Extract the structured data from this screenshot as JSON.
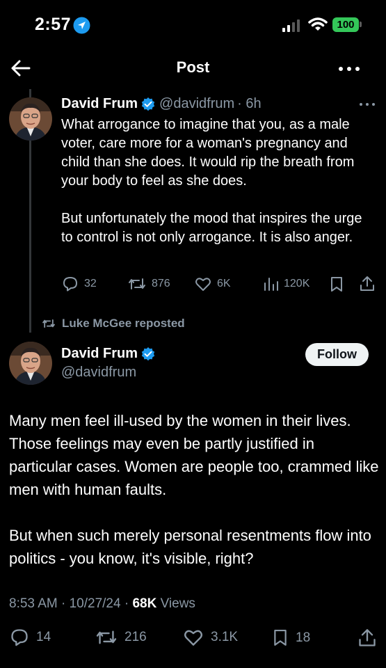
{
  "status_bar": {
    "time": "2:57",
    "battery": "100",
    "icons": [
      "location-arrow-icon",
      "signal-icon",
      "wifi-icon",
      "battery-icon"
    ]
  },
  "header": {
    "title": "Post",
    "back_icon": "back-arrow-icon",
    "more_icon": "more-horizontal-icon"
  },
  "parent_tweet": {
    "display_name": "David Frum",
    "handle": "@davidfrum",
    "time": "· 6h",
    "text_paragraphs": [
      "What arrogance to imagine that you, as a male voter, care more for a woman's pregnancy and child than she does. It would rip the breath from your body to feel as she does.",
      "But unfortunately the mood that inspires the urge to control is not only arrogance. It is also anger."
    ],
    "actions": {
      "replies": "32",
      "reposts": "876",
      "likes": "6K",
      "views": "120K"
    }
  },
  "reposted_by": "Luke McGee reposted",
  "main_tweet": {
    "display_name": "David Frum",
    "handle": "@davidfrum",
    "follow_label": "Follow",
    "text_paragraphs": [
      "Many men feel ill-used by the women in their lives. Those feelings may even be partly justified in particular cases. Women are people too, crammed like men with human faults.",
      "But when such merely personal resentments flow into politics - you know, it's visible, right?"
    ],
    "timestamp": "8:53 AM · 10/27/24 · ",
    "views_count": "68K",
    "views_label": " Views",
    "actions": {
      "replies": "14",
      "reposts": "216",
      "likes": "3.1K",
      "bookmarks": "18"
    }
  },
  "colors": {
    "background": "#000000",
    "text": "#ffffff",
    "secondary_text": "#8b98a5",
    "verified_blue": "#1d9bf0",
    "battery_green": "#34c759",
    "follow_bg": "#eff3f4"
  }
}
